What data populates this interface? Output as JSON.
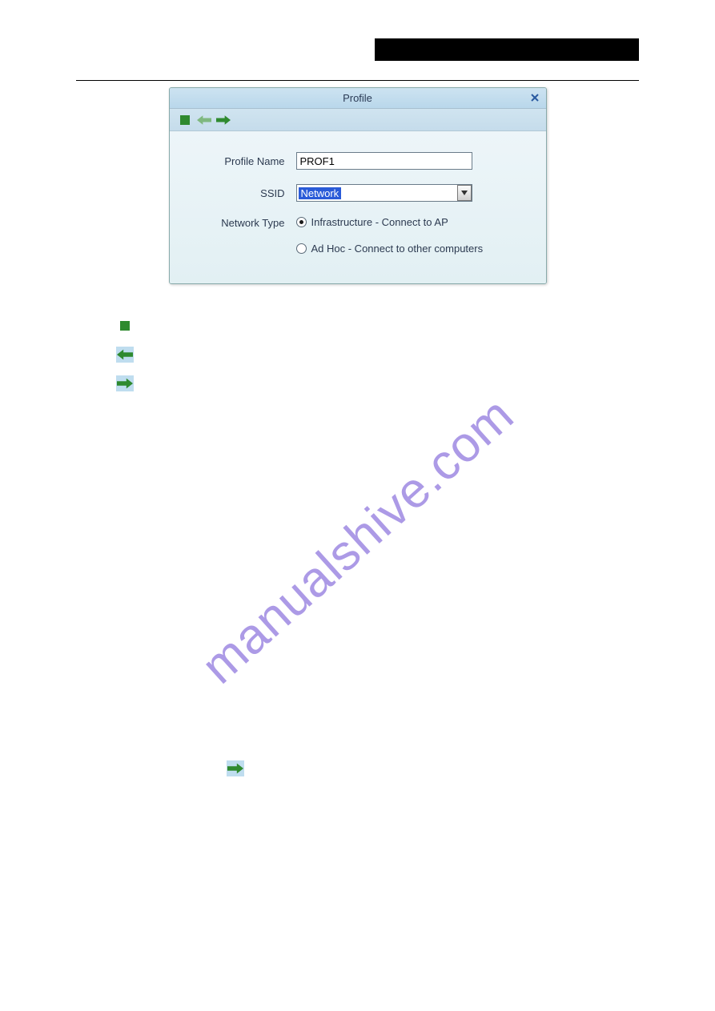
{
  "dialog": {
    "title": "Profile",
    "labels": {
      "profile_name": "Profile Name",
      "ssid": "SSID",
      "network_type": "Network Type"
    },
    "values": {
      "profile_name": "PROF1",
      "ssid": "Network"
    },
    "radio": {
      "infrastructure": "Infrastructure - Connect to AP",
      "adhoc": "Ad Hoc - Connect to other computers"
    }
  },
  "watermark": "manualshive.com"
}
